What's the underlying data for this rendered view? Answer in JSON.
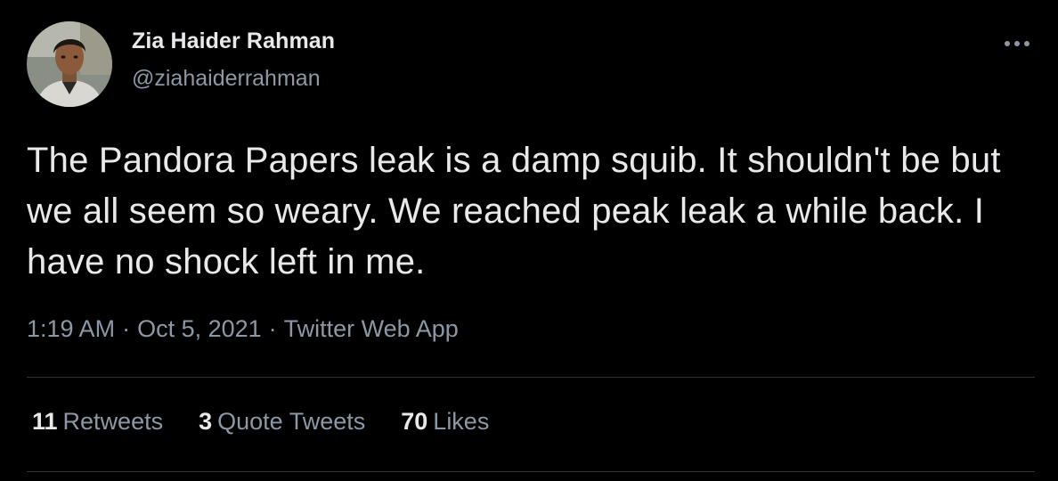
{
  "author": {
    "name": "Zia Haider Rahman",
    "handle": "@ziahaiderrahman",
    "avatar_icon": "profile-photo"
  },
  "tweet": {
    "text": "The Pandora Papers leak is a damp squib. It shouldn't be but we all seem so weary. We reached peak leak a while back. I have no shock left in me.",
    "time": "1:19 AM",
    "separator": "·",
    "date": "Oct 5, 2021",
    "source": "Twitter Web App"
  },
  "stats": [
    {
      "count": "11",
      "label": "Retweets"
    },
    {
      "count": "3",
      "label": "Quote Tweets"
    },
    {
      "count": "70",
      "label": "Likes"
    }
  ],
  "more_icon": "more-dots-icon",
  "colors": {
    "background": "#000000",
    "primary_text": "#e7e9ea",
    "secondary_text": "#8b98a5",
    "divider": "#2f3336"
  }
}
